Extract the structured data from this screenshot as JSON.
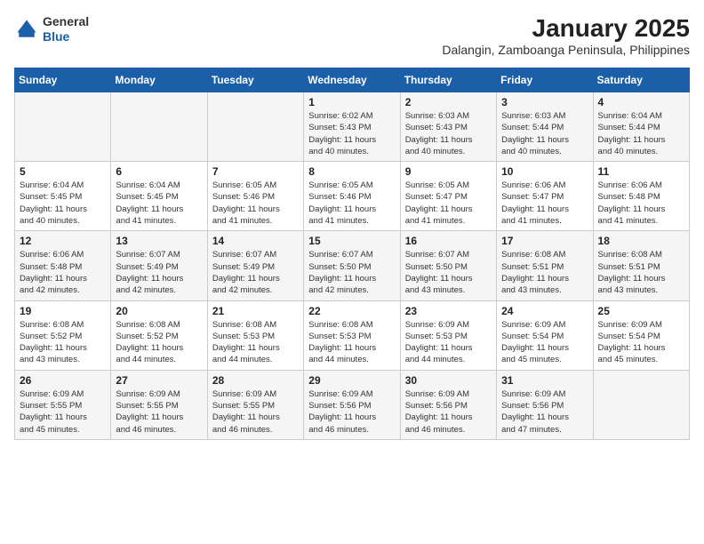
{
  "header": {
    "logo": {
      "general": "General",
      "blue": "Blue"
    },
    "title": "January 2025",
    "subtitle": "Dalangin, Zamboanga Peninsula, Philippines"
  },
  "calendar": {
    "weekdays": [
      "Sunday",
      "Monday",
      "Tuesday",
      "Wednesday",
      "Thursday",
      "Friday",
      "Saturday"
    ],
    "weeks": [
      [
        {
          "day": "",
          "info": ""
        },
        {
          "day": "",
          "info": ""
        },
        {
          "day": "",
          "info": ""
        },
        {
          "day": "1",
          "info": "Sunrise: 6:02 AM\nSunset: 5:43 PM\nDaylight: 11 hours\nand 40 minutes."
        },
        {
          "day": "2",
          "info": "Sunrise: 6:03 AM\nSunset: 5:43 PM\nDaylight: 11 hours\nand 40 minutes."
        },
        {
          "day": "3",
          "info": "Sunrise: 6:03 AM\nSunset: 5:44 PM\nDaylight: 11 hours\nand 40 minutes."
        },
        {
          "day": "4",
          "info": "Sunrise: 6:04 AM\nSunset: 5:44 PM\nDaylight: 11 hours\nand 40 minutes."
        }
      ],
      [
        {
          "day": "5",
          "info": "Sunrise: 6:04 AM\nSunset: 5:45 PM\nDaylight: 11 hours\nand 40 minutes."
        },
        {
          "day": "6",
          "info": "Sunrise: 6:04 AM\nSunset: 5:45 PM\nDaylight: 11 hours\nand 41 minutes."
        },
        {
          "day": "7",
          "info": "Sunrise: 6:05 AM\nSunset: 5:46 PM\nDaylight: 11 hours\nand 41 minutes."
        },
        {
          "day": "8",
          "info": "Sunrise: 6:05 AM\nSunset: 5:46 PM\nDaylight: 11 hours\nand 41 minutes."
        },
        {
          "day": "9",
          "info": "Sunrise: 6:05 AM\nSunset: 5:47 PM\nDaylight: 11 hours\nand 41 minutes."
        },
        {
          "day": "10",
          "info": "Sunrise: 6:06 AM\nSunset: 5:47 PM\nDaylight: 11 hours\nand 41 minutes."
        },
        {
          "day": "11",
          "info": "Sunrise: 6:06 AM\nSunset: 5:48 PM\nDaylight: 11 hours\nand 41 minutes."
        }
      ],
      [
        {
          "day": "12",
          "info": "Sunrise: 6:06 AM\nSunset: 5:48 PM\nDaylight: 11 hours\nand 42 minutes."
        },
        {
          "day": "13",
          "info": "Sunrise: 6:07 AM\nSunset: 5:49 PM\nDaylight: 11 hours\nand 42 minutes."
        },
        {
          "day": "14",
          "info": "Sunrise: 6:07 AM\nSunset: 5:49 PM\nDaylight: 11 hours\nand 42 minutes."
        },
        {
          "day": "15",
          "info": "Sunrise: 6:07 AM\nSunset: 5:50 PM\nDaylight: 11 hours\nand 42 minutes."
        },
        {
          "day": "16",
          "info": "Sunrise: 6:07 AM\nSunset: 5:50 PM\nDaylight: 11 hours\nand 43 minutes."
        },
        {
          "day": "17",
          "info": "Sunrise: 6:08 AM\nSunset: 5:51 PM\nDaylight: 11 hours\nand 43 minutes."
        },
        {
          "day": "18",
          "info": "Sunrise: 6:08 AM\nSunset: 5:51 PM\nDaylight: 11 hours\nand 43 minutes."
        }
      ],
      [
        {
          "day": "19",
          "info": "Sunrise: 6:08 AM\nSunset: 5:52 PM\nDaylight: 11 hours\nand 43 minutes."
        },
        {
          "day": "20",
          "info": "Sunrise: 6:08 AM\nSunset: 5:52 PM\nDaylight: 11 hours\nand 44 minutes."
        },
        {
          "day": "21",
          "info": "Sunrise: 6:08 AM\nSunset: 5:53 PM\nDaylight: 11 hours\nand 44 minutes."
        },
        {
          "day": "22",
          "info": "Sunrise: 6:08 AM\nSunset: 5:53 PM\nDaylight: 11 hours\nand 44 minutes."
        },
        {
          "day": "23",
          "info": "Sunrise: 6:09 AM\nSunset: 5:53 PM\nDaylight: 11 hours\nand 44 minutes."
        },
        {
          "day": "24",
          "info": "Sunrise: 6:09 AM\nSunset: 5:54 PM\nDaylight: 11 hours\nand 45 minutes."
        },
        {
          "day": "25",
          "info": "Sunrise: 6:09 AM\nSunset: 5:54 PM\nDaylight: 11 hours\nand 45 minutes."
        }
      ],
      [
        {
          "day": "26",
          "info": "Sunrise: 6:09 AM\nSunset: 5:55 PM\nDaylight: 11 hours\nand 45 minutes."
        },
        {
          "day": "27",
          "info": "Sunrise: 6:09 AM\nSunset: 5:55 PM\nDaylight: 11 hours\nand 46 minutes."
        },
        {
          "day": "28",
          "info": "Sunrise: 6:09 AM\nSunset: 5:55 PM\nDaylight: 11 hours\nand 46 minutes."
        },
        {
          "day": "29",
          "info": "Sunrise: 6:09 AM\nSunset: 5:56 PM\nDaylight: 11 hours\nand 46 minutes."
        },
        {
          "day": "30",
          "info": "Sunrise: 6:09 AM\nSunset: 5:56 PM\nDaylight: 11 hours\nand 46 minutes."
        },
        {
          "day": "31",
          "info": "Sunrise: 6:09 AM\nSunset: 5:56 PM\nDaylight: 11 hours\nand 47 minutes."
        },
        {
          "day": "",
          "info": ""
        }
      ]
    ]
  }
}
